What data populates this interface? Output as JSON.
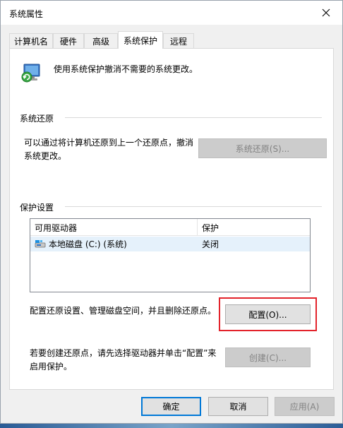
{
  "window": {
    "title": "系统属性"
  },
  "tabs": [
    {
      "label": "计算机名",
      "active": false
    },
    {
      "label": "硬件",
      "active": false
    },
    {
      "label": "高级",
      "active": false
    },
    {
      "label": "系统保护",
      "active": true
    },
    {
      "label": "远程",
      "active": false
    }
  ],
  "header": {
    "text": "使用系统保护撤消不需要的系统更改。",
    "icon": "system-protection-icon"
  },
  "restore": {
    "group_label": "系统还原",
    "description_line1": "可以通过将计算机还原到上一个还原点，撤消",
    "description_line2": "系统更改。",
    "button_label": "系统还原(S)..."
  },
  "protection": {
    "group_label": "保护设置",
    "columns": [
      "可用驱动器",
      "保护"
    ],
    "rows": [
      {
        "drive": "本地磁盘 (C:) (系统)",
        "protection": "关闭",
        "icon": "drive-icon"
      }
    ],
    "configure_text": "配置还原设置、管理磁盘空间，并且删除还原点。",
    "configure_button": "配置(O)...",
    "create_text_line1": "若要创建还原点，请先选择驱动器并单击“配置”来",
    "create_text_line2": "启用保护。",
    "create_button": "创建(C)..."
  },
  "footer": {
    "ok": "确定",
    "cancel": "取消",
    "apply": "应用(A)"
  },
  "colors": {
    "accent": "#0078d7",
    "highlight": "#e3232b",
    "selection": "#e5f1fb"
  }
}
